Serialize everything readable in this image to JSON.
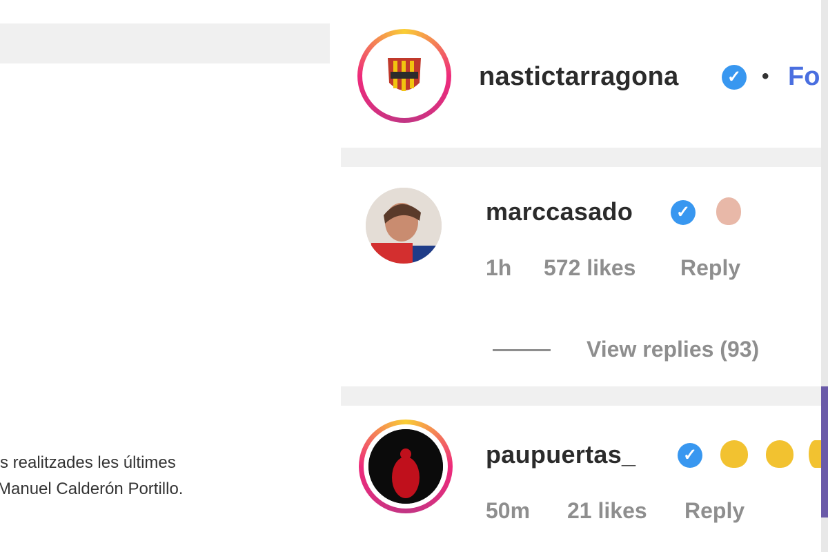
{
  "caption": {
    "line1": "rs realitzades les últimes",
    "line2": "Manuel Calderón Portillo."
  },
  "post_header": {
    "username": "nastictarragona",
    "verified_icon": "verified-badge-icon",
    "separator": "•",
    "follow_label": "Fo"
  },
  "comments": [
    {
      "username": "marccasado",
      "verified_icon": "verified-badge-icon",
      "emoji_icon": "clapping-hands-icon",
      "time": "1h",
      "likes": "572 likes",
      "reply_label": "Reply",
      "view_replies": "View replies (93)"
    },
    {
      "username": "paupuertas_",
      "verified_icon": "verified-badge-icon",
      "emoji_icon": "lemon-icon",
      "time": "50m",
      "likes": "21 likes",
      "reply_label": "Reply"
    }
  ],
  "colors": {
    "verified": "#3897f0",
    "follow": "#4a6fe0",
    "meta_text": "#8e8e8e"
  }
}
